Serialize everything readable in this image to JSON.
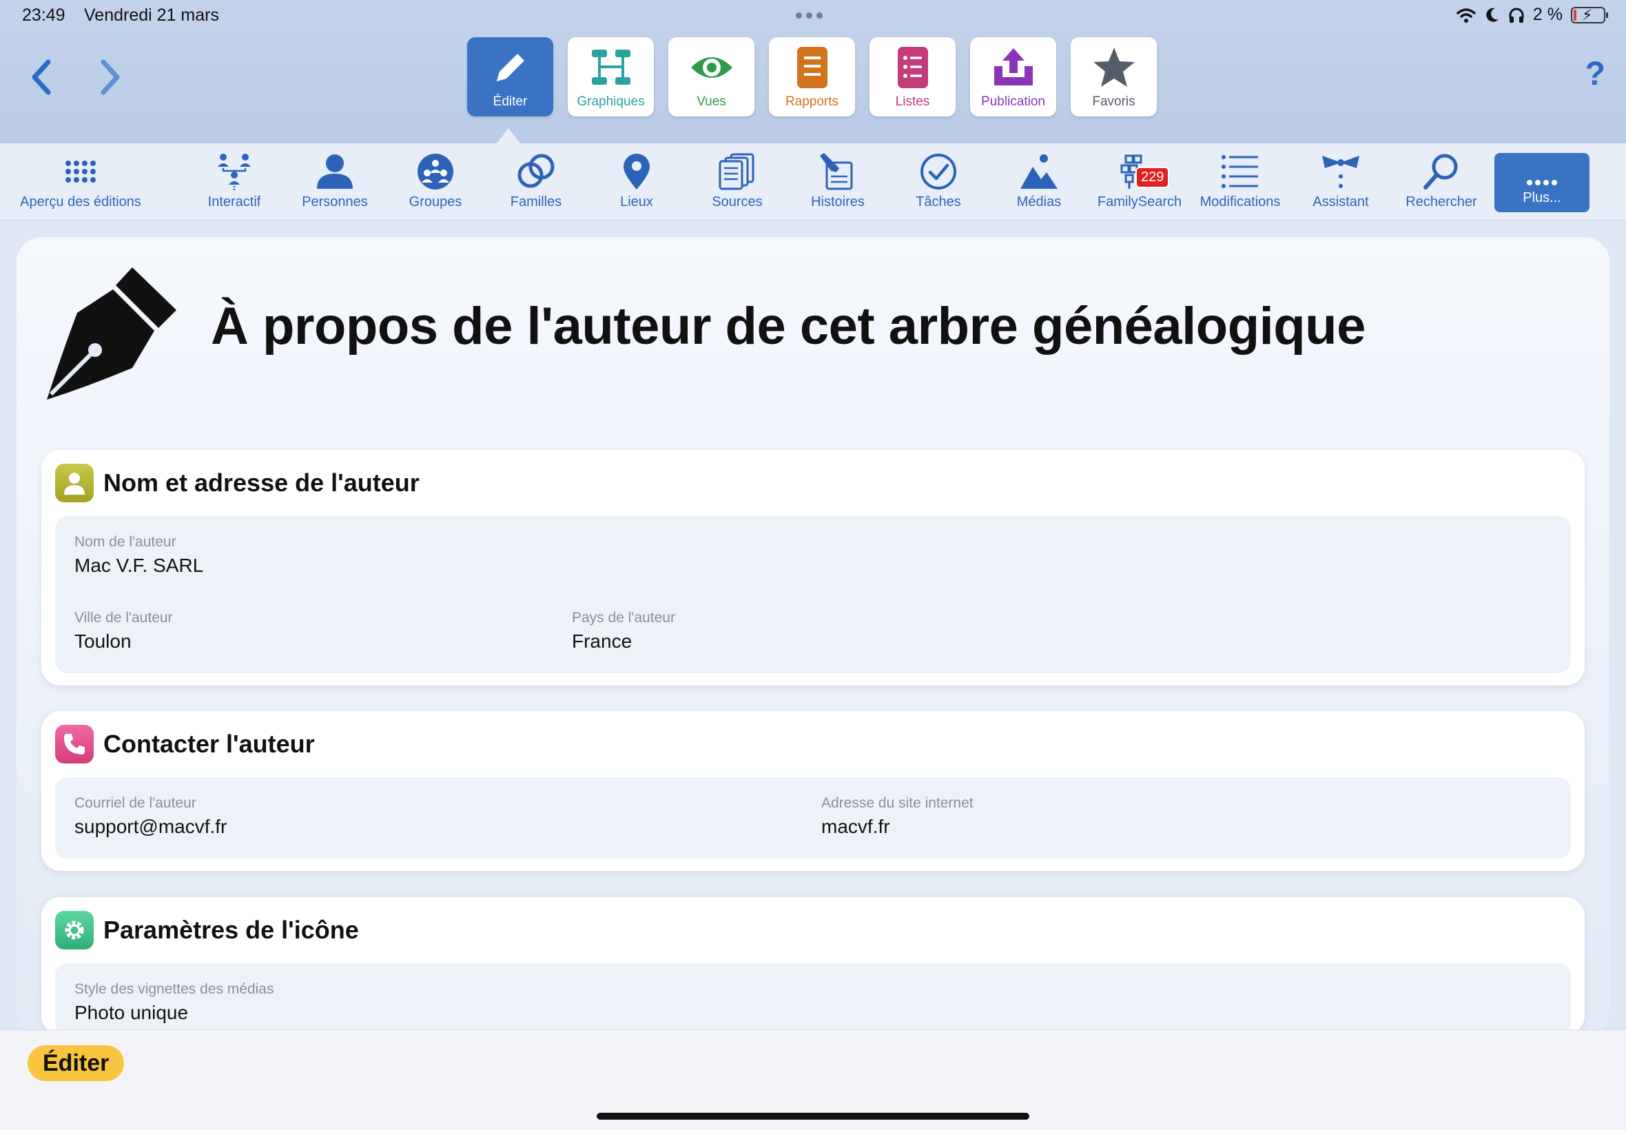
{
  "status_bar": {
    "time": "23:49",
    "date": "Vendredi 21 mars",
    "battery": "2 %"
  },
  "nav": {
    "help": "?"
  },
  "mode_tabs": [
    {
      "label": "Éditer",
      "color": "#3a73c4",
      "icon": "pencil-icon",
      "active": true
    },
    {
      "label": "Graphiques",
      "color": "#2aa3a0",
      "icon": "chart-tree-icon"
    },
    {
      "label": "Vues",
      "color": "#2f9a4a",
      "icon": "eye-icon"
    },
    {
      "label": "Rapports",
      "color": "#d2731e",
      "icon": "document-icon"
    },
    {
      "label": "Listes",
      "color": "#c43c7a",
      "icon": "list-icon"
    },
    {
      "label": "Publication",
      "color": "#8a35b8",
      "icon": "upload-icon"
    },
    {
      "label": "Favoris",
      "color": "#555d6b",
      "icon": "star-icon"
    }
  ],
  "tools": [
    {
      "label": "Aperçu des éditions",
      "icon": "grid-dots-icon"
    },
    {
      "label": "Interactif",
      "icon": "interactive-tree-icon"
    },
    {
      "label": "Personnes",
      "icon": "person-icon"
    },
    {
      "label": "Groupes",
      "icon": "group-icon"
    },
    {
      "label": "Familles",
      "icon": "rings-icon"
    },
    {
      "label": "Lieux",
      "icon": "map-pin-icon"
    },
    {
      "label": "Sources",
      "icon": "documents-icon"
    },
    {
      "label": "Histoires",
      "icon": "pencil-paper-icon"
    },
    {
      "label": "Tâches",
      "icon": "checkmark-circle-icon"
    },
    {
      "label": "Médias",
      "icon": "mountain-image-icon"
    },
    {
      "label": "FamilySearch",
      "icon": "familysearch-tree-icon",
      "badge": "229"
    },
    {
      "label": "Modifications",
      "icon": "list-lines-icon"
    },
    {
      "label": "Assistant",
      "icon": "bowtie-icon"
    },
    {
      "label": "Rechercher",
      "icon": "magnifier-icon"
    },
    {
      "label": "Plus...",
      "icon": "more-dots-icon"
    }
  ],
  "page": {
    "title": "À propos de l'auteur de cet arbre généalogique",
    "icon": "fountain-pen-icon"
  },
  "sections": {
    "author": {
      "title": "Nom et adresse de l'auteur",
      "icon": "person-card-icon",
      "color": "#b5b42c",
      "name_label": "Nom de l'auteur",
      "name_value": "Mac V.F. SARL",
      "city_label": "Ville de l'auteur",
      "city_value": "Toulon",
      "country_label": "Pays de l'auteur",
      "country_value": "France"
    },
    "contact": {
      "title": "Contacter l'auteur",
      "icon": "phone-icon",
      "color": "#e8538f",
      "email_label": "Courriel de l'auteur",
      "email_value": "support@macvf.fr",
      "website_label": "Adresse du site internet",
      "website_value": "macvf.fr"
    },
    "icon_settings": {
      "title": "Paramètres de l'icône",
      "icon": "gear-icon",
      "color": "#3cc08a",
      "thumb_label": "Style des vignettes des médias",
      "thumb_value": "Photo unique"
    }
  },
  "bottom": {
    "edit_button": "Éditer"
  }
}
